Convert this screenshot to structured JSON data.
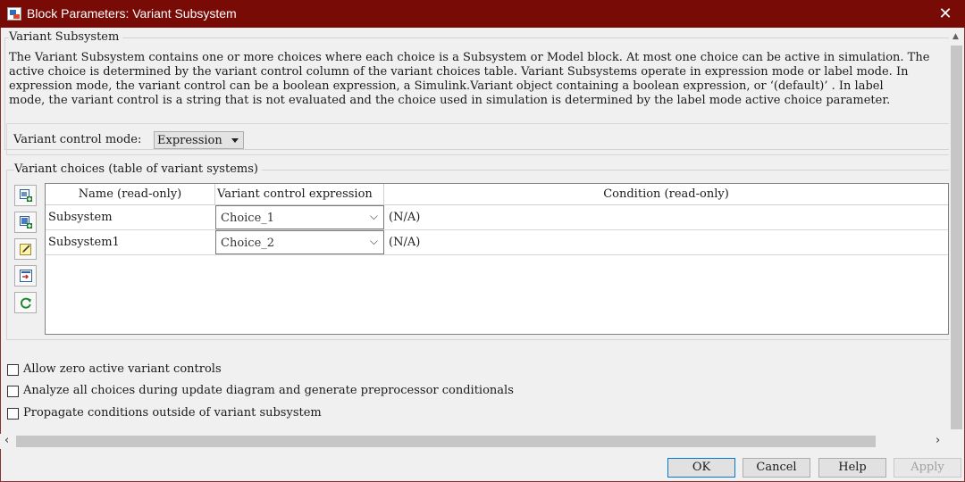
{
  "window": {
    "title": "Block Parameters: Variant Subsystem",
    "close_glyph": "✕",
    "app_icon": "simulink-block-icon"
  },
  "description": {
    "group_title": "Variant Subsystem",
    "lines": [
      "The Variant Subsystem contains one or more choices where each choice is a Subsystem or Model block. At most one choice can be active in simulation. The",
      "active choice is determined by the variant control column of the variant choices table. Variant Subsystems operate in expression mode or label mode. In",
      "expression mode, the variant control can be a boolean expression, a Simulink.Variant object containing a boolean expression, or  ‘(default)’ . In label",
      "mode, the variant control is a string that is not evaluated and the choice used in simulation is determined by the label mode active choice parameter."
    ]
  },
  "control_mode": {
    "label": "Variant control mode:",
    "value": "Expression"
  },
  "choices": {
    "group_title": "Variant choices (table of variant systems)",
    "toolbar": [
      "add-choice-icon",
      "add-model-choice-icon",
      "edit-choice-icon",
      "open-choice-icon",
      "refresh-icon"
    ],
    "columns": [
      "Name (read-only)",
      "Variant control expression",
      "Condition (read-only)"
    ],
    "rows": [
      {
        "name": "Subsystem",
        "control": "Choice_1",
        "condition": "(N/A)"
      },
      {
        "name": "Subsystem1",
        "control": "Choice_2",
        "condition": "(N/A)"
      }
    ]
  },
  "options": [
    {
      "label": "Allow zero active variant controls",
      "checked": false
    },
    {
      "label": "Analyze all choices during update diagram and generate preprocessor conditionals",
      "checked": false
    },
    {
      "label": "Propagate conditions outside of variant subsystem",
      "checked": false
    }
  ],
  "buttons": {
    "ok": "OK",
    "cancel": "Cancel",
    "help": "Help",
    "apply": "Apply"
  },
  "colors": {
    "titlebar": "#780b05",
    "default_button_border": "#0078d7"
  }
}
